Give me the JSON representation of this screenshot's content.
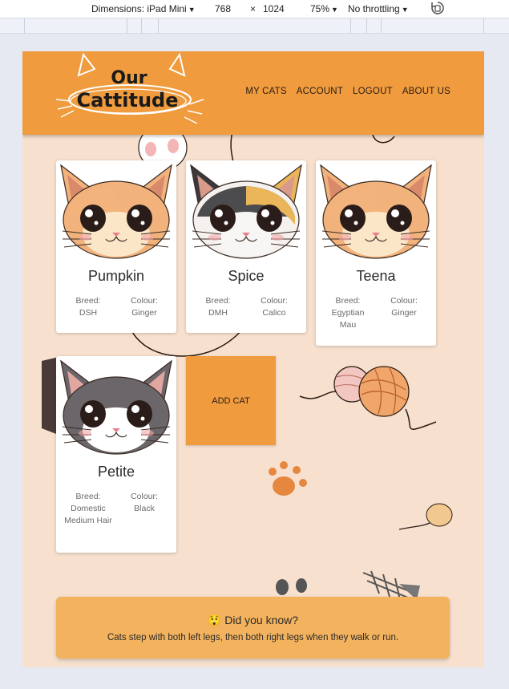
{
  "devtools": {
    "device_label": "Dimensions: iPad Mini",
    "width": "768",
    "times": "×",
    "height": "1024",
    "zoom": "75%",
    "throttle": "No throttling"
  },
  "header": {
    "logo_line1": "Our",
    "logo_line2": "Cattitude",
    "nav": [
      "MY CATS",
      "ACCOUNT",
      "LOGOUT",
      "ABOUT US"
    ]
  },
  "cards": [
    {
      "name": "Pumpkin",
      "breed_label": "Breed:",
      "breed": "DSH",
      "colour_label": "Colour:",
      "colour": "Ginger",
      "palette": "ginger"
    },
    {
      "name": "Spice",
      "breed_label": "Breed:",
      "breed": "DMH",
      "colour_label": "Colour:",
      "colour": "Calico",
      "palette": "calico"
    },
    {
      "name": "Teena",
      "breed_label": "Breed:",
      "breed": "Egyptian Mau",
      "colour_label": "Colour:",
      "colour": "Ginger",
      "palette": "ginger"
    },
    {
      "name": "Petite",
      "breed_label": "Breed:",
      "breed": "Domestic Medium Hair",
      "colour_label": "Colour:",
      "colour": "Black",
      "palette": "grey"
    }
  ],
  "add_cat_label": "ADD CAT",
  "fact": {
    "emoji": "😲",
    "title": "Did you know?",
    "text": "Cats step with both left legs, then both right legs when they walk or run."
  },
  "colors": {
    "header": "#ef9b3e",
    "background": "#f7e0ce",
    "fact_box": "#f3b25d"
  }
}
